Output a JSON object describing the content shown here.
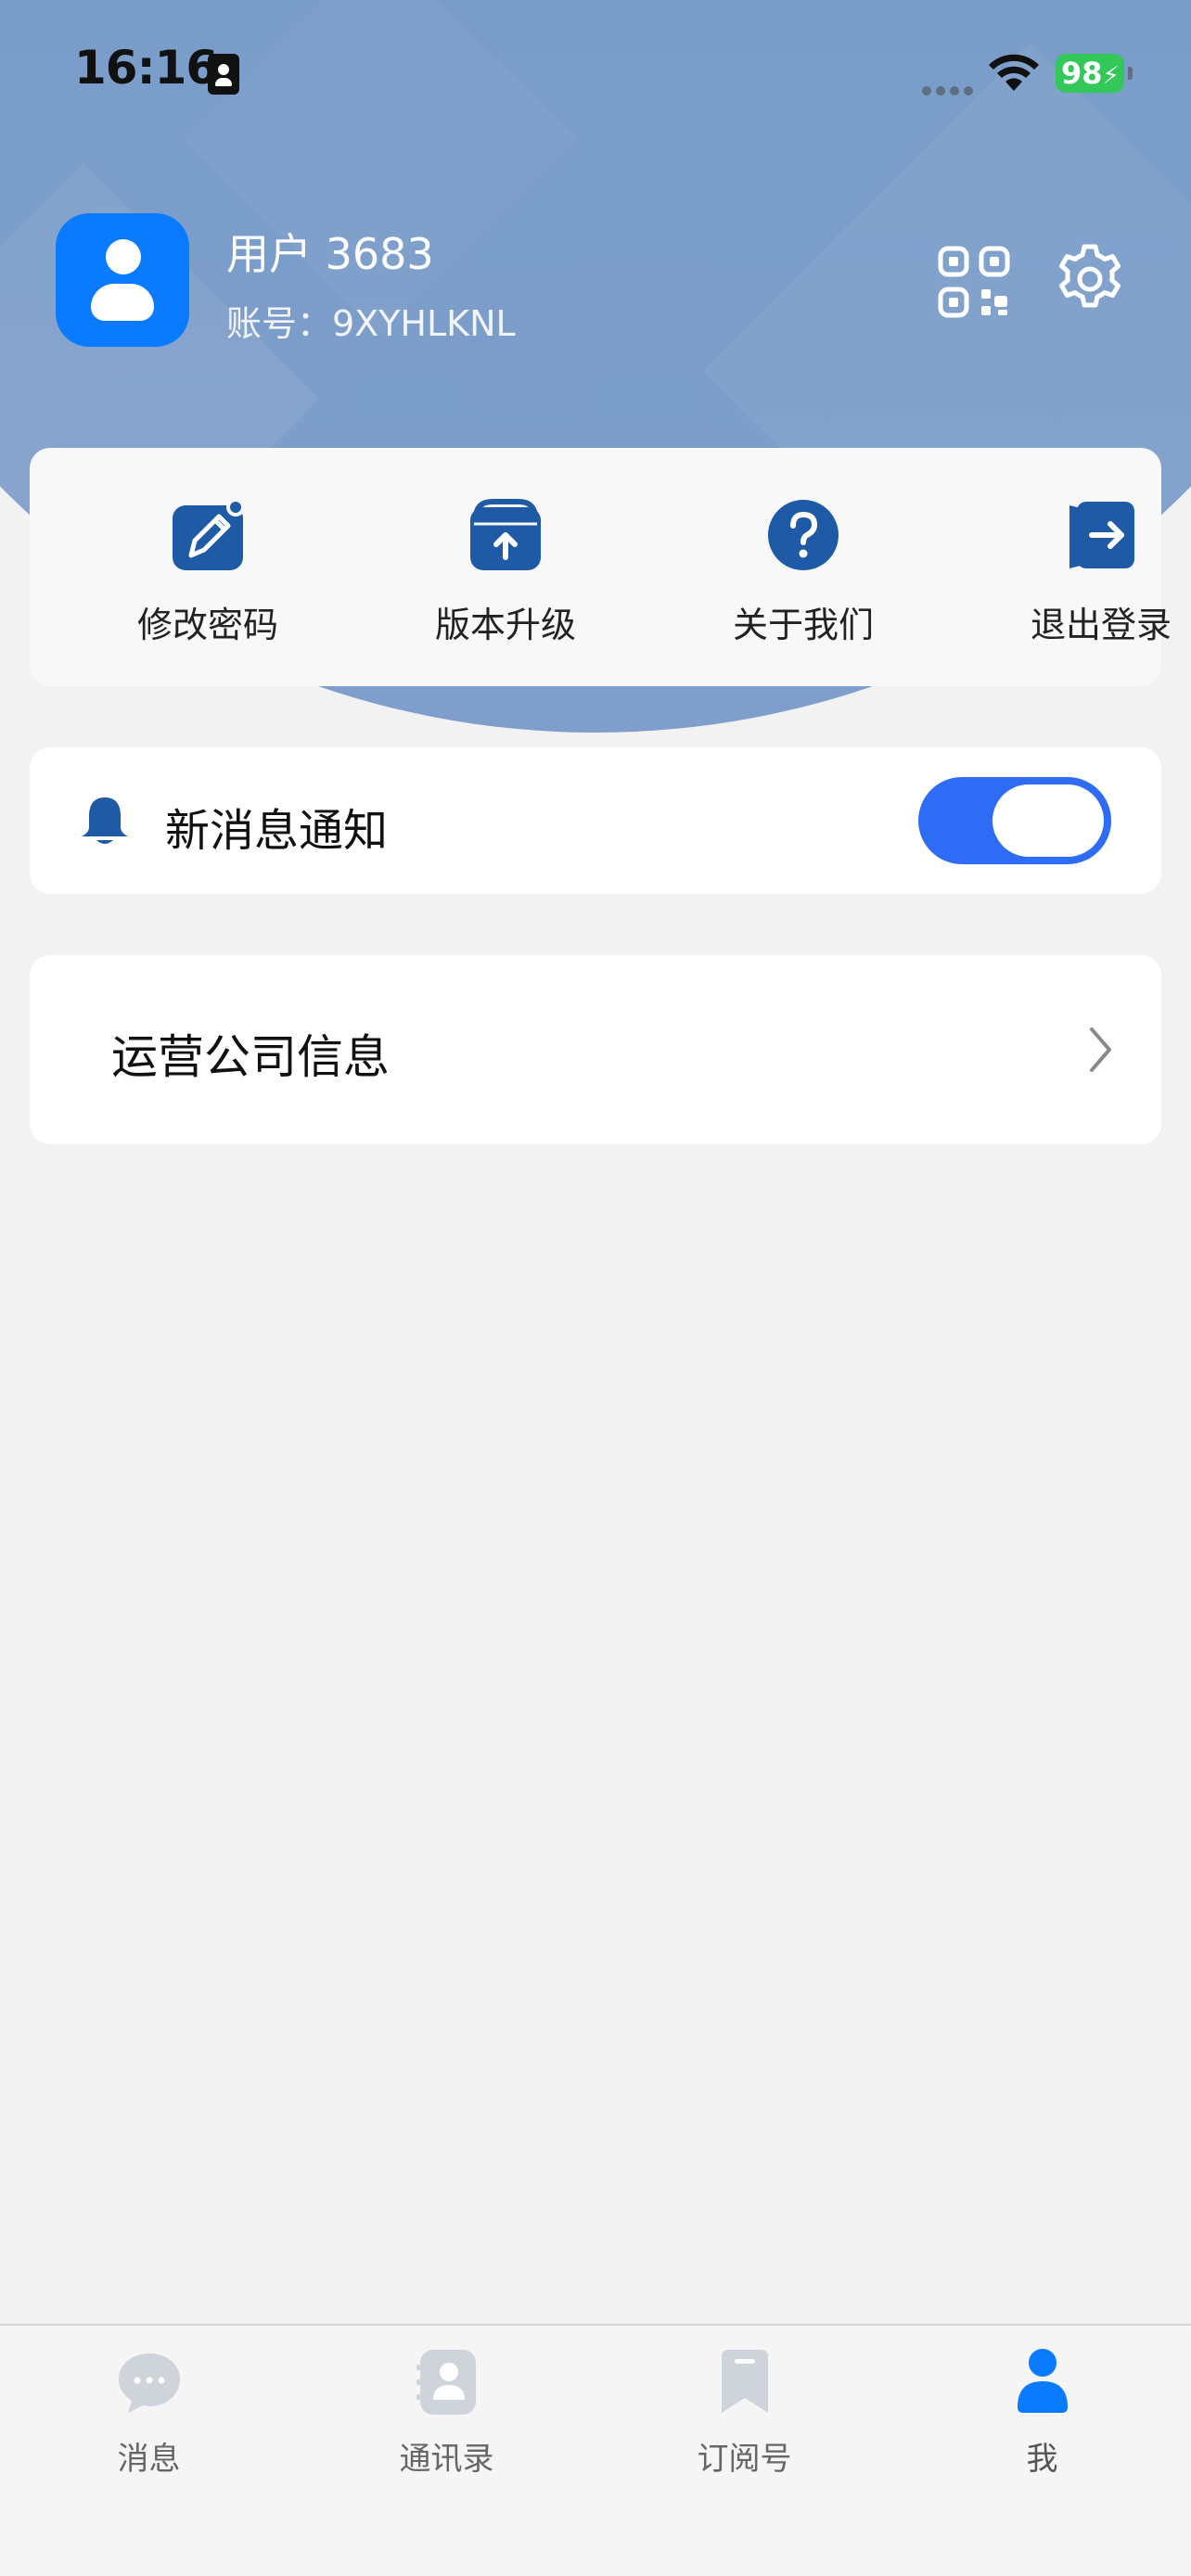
{
  "status_bar": {
    "time": "16:16",
    "battery": "98",
    "icons": [
      "contact-card-icon",
      "cellular-signal-icon",
      "wifi-icon",
      "battery-charging-icon"
    ]
  },
  "profile": {
    "name": "用户 3683",
    "account": "账号：9XYHLKNL",
    "icons": [
      "avatar-icon",
      "qr-code-icon",
      "gear-icon"
    ]
  },
  "quick_actions": [
    {
      "label": "修改密码",
      "icon": "edit-pencil-icon"
    },
    {
      "label": "版本升级",
      "icon": "upgrade-icon"
    },
    {
      "label": "关于我们",
      "icon": "question-icon"
    },
    {
      "label": "退出登录",
      "icon": "logout-icon"
    }
  ],
  "notification": {
    "label": "新消息通知",
    "icon": "bell-icon",
    "enabled": true
  },
  "company": {
    "label": "运营公司信息",
    "icon": "chevron-right-icon"
  },
  "tabs": [
    {
      "label": "消息",
      "icon": "chat-bubble-icon",
      "active": false
    },
    {
      "label": "通讯录",
      "icon": "contacts-book-icon",
      "active": false
    },
    {
      "label": "订阅号",
      "icon": "bookmark-icon",
      "active": false
    },
    {
      "label": "我",
      "icon": "person-icon",
      "active": true
    }
  ],
  "colors": {
    "accent": "#2e6cf6",
    "icon_blue": "#1f5aa6",
    "avatar_blue": "#0a7aff",
    "battery_green": "#34c759",
    "tab_inactive": "#cfd3da"
  }
}
